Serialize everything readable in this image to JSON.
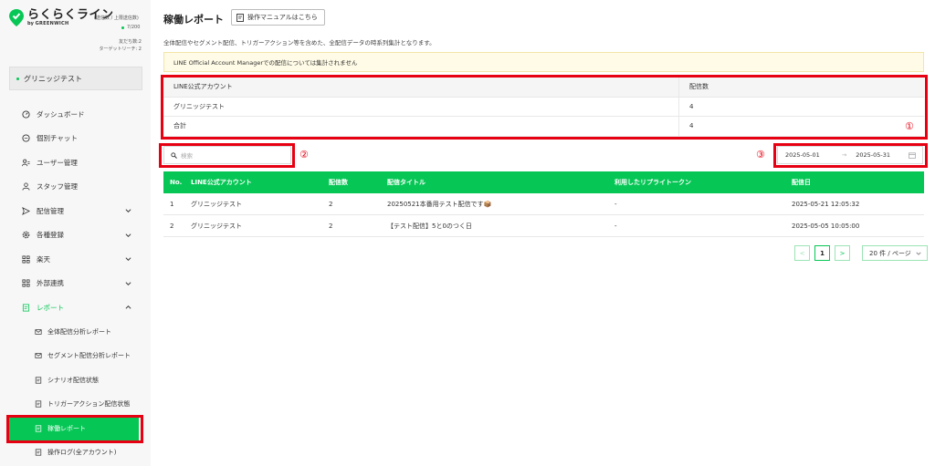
{
  "brand": {
    "title": "らくらくライン",
    "by": "by",
    "by_company": "GREENWICH",
    "usage_label": "(送信数 / 上限送信数)",
    "usage_value": "7/200",
    "friends_line": "友だち数:2",
    "target_reach_line": "ターゲットリーチ: 2",
    "accent": "#06c755"
  },
  "account": {
    "name": "グリニッジテスト"
  },
  "nav": {
    "dashboard": "ダッシュボード",
    "chat": "個別チャット",
    "users": "ユーザー管理",
    "staff": "スタッフ管理",
    "delivery": "配信管理",
    "registration": "各種登録",
    "rakuten": "楽天",
    "external": "外部連携",
    "report": "レポート",
    "report_sub": [
      "全体配信分析レポート",
      "セグメント配信分析レポート",
      "シナリオ配信状態",
      "トリガーアクション配信状態",
      "稼働レポート",
      "操作ログ(全アカウント)"
    ]
  },
  "page": {
    "title": "稼働レポート",
    "manual_button": "操作マニュアルはこちら",
    "description": "全体配信やセグメント配信、トリガーアクション等を含めた、全配信データの時系列集計となります。",
    "notice": "LINE Official Account Managerでの配信については集計されません"
  },
  "summary": {
    "headers": [
      "LINE公式アカウント",
      "配信数"
    ],
    "rows": [
      [
        "グリニッジテスト",
        "4"
      ],
      [
        "合計",
        "4"
      ]
    ]
  },
  "annotations": {
    "one": "①",
    "two": "②",
    "three": "③"
  },
  "search": {
    "placeholder": "検索"
  },
  "date_range": {
    "start": "2025-05-01",
    "arrow": "→",
    "end": "2025-05-31"
  },
  "table": {
    "headers": [
      "No.",
      "LINE公式アカウント",
      "配信数",
      "配信タイトル",
      "利用したリプライトークン",
      "配信日"
    ],
    "rows": [
      [
        "1",
        "グリニッジテスト",
        "2",
        "20250521本番用テスト配信です📦",
        "-",
        "2025-05-21 12:05:32"
      ],
      [
        "2",
        "グリニッジテスト",
        "2",
        "【テスト配信】5と0のつく日",
        "-",
        "2025-05-05 10:05:00"
      ]
    ]
  },
  "pagination": {
    "prev": "<",
    "current": "1",
    "next": ">",
    "page_size": "20 件 / ページ"
  },
  "colors": {
    "highlight": "#e60012",
    "green": "#06c755",
    "notice_bg": "#fffbe6"
  }
}
